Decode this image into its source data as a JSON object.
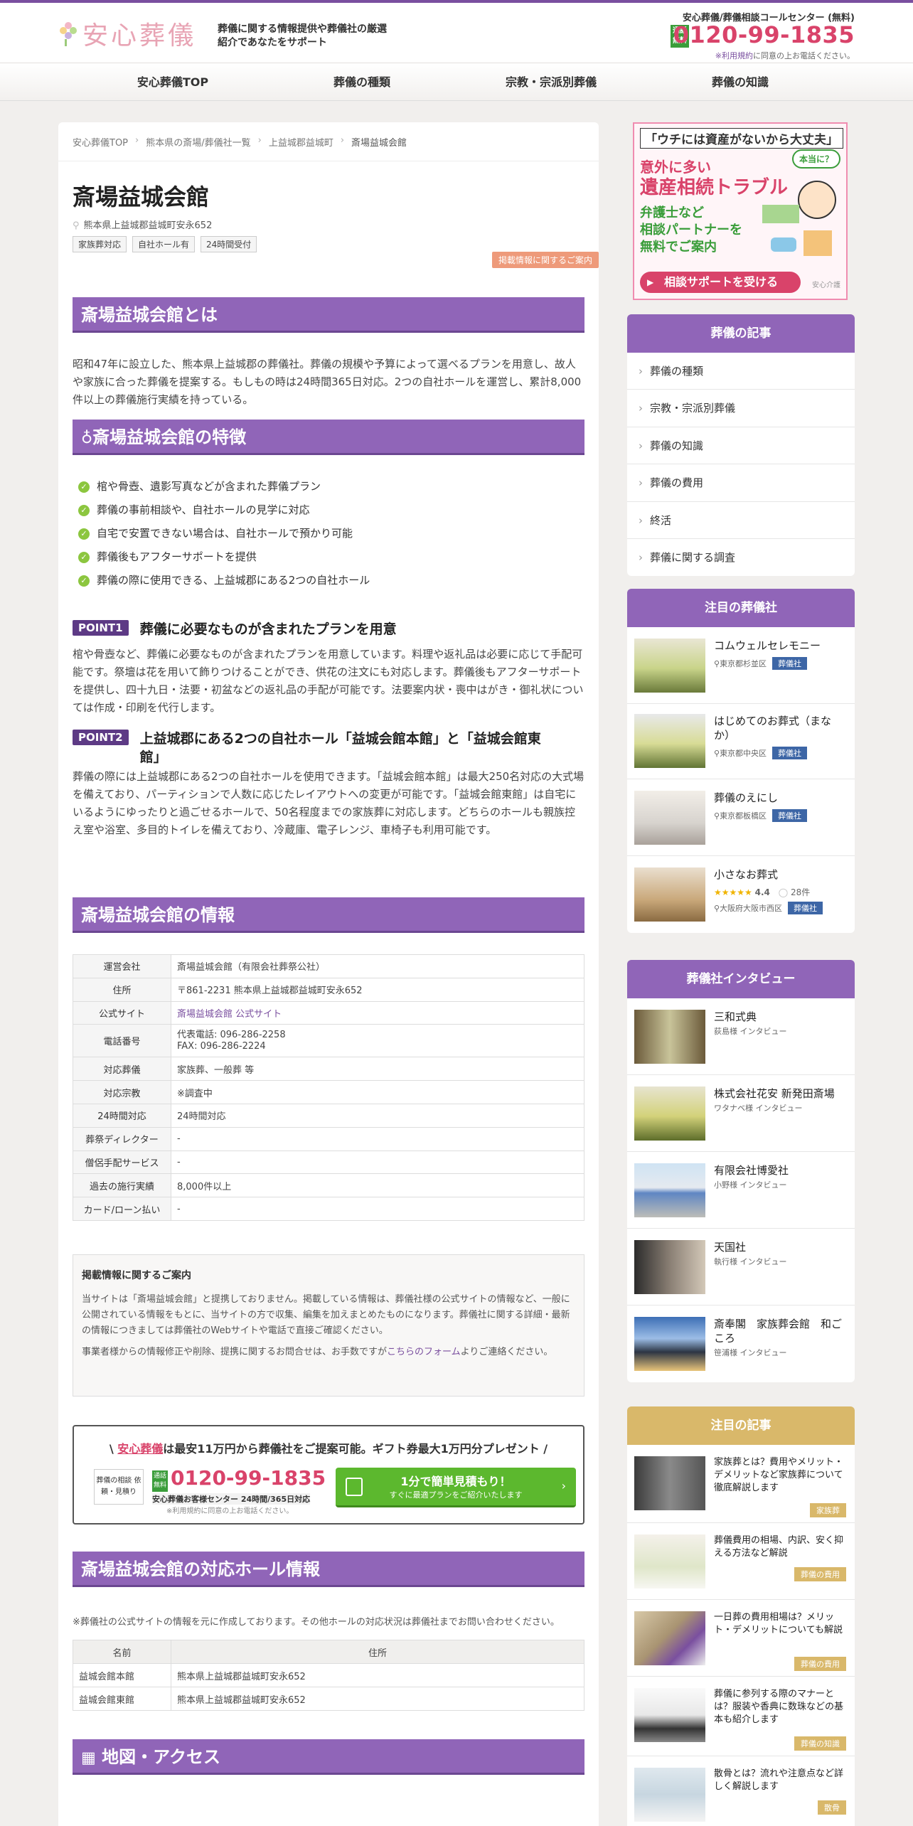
{
  "header": {
    "logo_text": "安心葬儀",
    "tagline": "葬儀に関する情報提供や葬儀社の厳選紹介であなたをサポート",
    "callcenter_title": "安心葬儀/葬儀相談コールセンター (無料)",
    "free_badge": "通話無料",
    "phone": "0120-99-1835",
    "note_link": "※利用規約",
    "note_text": "に同意の上お電話ください。"
  },
  "nav": [
    "安心葬儀TOP",
    "葬儀の種類",
    "宗教・宗派別葬儀",
    "葬儀の知識"
  ],
  "breadcrumb": [
    "安心葬儀TOP",
    "熊本県の斎場/葬儀社一覧",
    "上益城郡益城町",
    "斎場益城会館"
  ],
  "page": {
    "title": "斎場益城会館",
    "address": "熊本県上益城郡益城町安永652",
    "tags": [
      "家族葬対応",
      "自社ホール有",
      "24時間受付"
    ],
    "info_button": "掲載情報に関するご案内"
  },
  "about": {
    "heading": "斎場益城会館とは",
    "text": "昭和47年に設立した、熊本県上益城郡の葬儀社。葬儀の規模や予算によって選べるプランを用意し、故人や家族に合った葬儀を提案する。もしもの時は24時間365日対応。2つの自社ホールを運営し、累計8,000件以上の葬儀施行実績を持っている。"
  },
  "features": {
    "heading": "斎場益城会館の特徴",
    "items": [
      "棺や骨壺、遺影写真などが含まれた葬儀プラン",
      "葬儀の事前相談や、自社ホールの見学に対応",
      "自宅で安置できない場合は、自社ホールで預かり可能",
      "葬儀後もアフターサポートを提供",
      "葬儀の際に使用できる、上益城郡にある2つの自社ホール"
    ]
  },
  "points": [
    {
      "badge": "POINT1",
      "title": "葬儀に必要なものが含まれたプランを用意",
      "text": "棺や骨壺など、葬儀に必要なものが含まれたプランを用意しています。料理や返礼品は必要に応じて手配可能です。祭壇は花を用いて飾りつけることができ、供花の注文にも対応します。葬儀後もアフターサポートを提供し、四十九日・法要・初盆などの返礼品の手配が可能です。法要案内状・喪中はがき・御礼状については作成・印刷を代行します。"
    },
    {
      "badge": "POINT2",
      "title": "上益城郡にある2つの自社ホール「益城会館本館」と「益城会館東館」",
      "text": "葬儀の際には上益城郡にある2つの自社ホールを使用できます。「益城会館本館」は最大250名対応の大式場を備えており、パーティションで人数に応じたレイアウトへの変更が可能です。「益城会館東館」は自宅にいるようにゆったりと過ごせるホールで、50名程度までの家族葬に対応します。どちらのホールも親族控え室や浴室、多目的トイレを備えており、冷蔵庫、電子レンジ、車椅子も利用可能です。"
    }
  ],
  "info": {
    "heading": "斎場益城会館の情報",
    "rows": [
      {
        "k": "運営会社",
        "v": "斎場益城会館（有限会社葬祭公社）"
      },
      {
        "k": "住所",
        "v": "〒861-2231 熊本県上益城郡益城町安永652"
      },
      {
        "k": "公式サイト",
        "v": "斎場益城会館 公式サイト"
      },
      {
        "k": "電話番号",
        "v": "代表電話: 096-286-2258",
        "v2": "FAX: 096-286-2224"
      },
      {
        "k": "対応葬儀",
        "v": "家族葬、一般葬 等"
      },
      {
        "k": "対応宗教",
        "v": "※調査中"
      },
      {
        "k": "24時間対応",
        "v": "24時間対応"
      },
      {
        "k": "葬祭ディレクター",
        "v": "-"
      },
      {
        "k": "僧侶手配サービス",
        "v": "-"
      },
      {
        "k": "過去の施行実績",
        "v": "8,000件以上"
      },
      {
        "k": "カード/ローン払い",
        "v": "-"
      }
    ]
  },
  "notice": {
    "title": "掲載情報に関するご案内",
    "p1": "当サイトは「斎場益城会館」と提携しておりません。掲載している情報は、葬儀社様の公式サイトの情報など、一般に公開されている情報をもとに、当サイトの方で収集、編集を加えまとめたものになります。葬儀社に関する詳細・最新の情報につきましては葬儀社のWebサイトや電話で直接ご確認ください。",
    "p2_a": "事業者様からの情報修正や削除、提携に関するお問合せは、お手数ですが",
    "p2_link": "こちらのフォーム",
    "p2_b": "よりご連絡ください。"
  },
  "cta": {
    "head_pre": "\\ ",
    "head_brand": "安心葬儀",
    "head_text": "は最安11万円から葬儀社をご提案可能。ギフト券最大1万円分プレゼント /",
    "box": "葬儀の相談 依頼・見積り",
    "badge": "通話無料",
    "phone": "0120-99-1835",
    "sub": "安心葬儀お客様センター 24時間/365日対応",
    "note": "※利用規約に同意の上お電話ください。",
    "btn1": "1分で簡単見積もり！",
    "btn2": "すぐに最適プランをご紹介いたします"
  },
  "halls": {
    "heading": "斎場益城会館の対応ホール情報",
    "note": "※葬儀社の公式サイトの情報を元に作成しております。その他ホールの対応状況は葬儀社までお問い合わせください。",
    "headers": [
      "名前",
      "住所"
    ],
    "rows": [
      [
        "益城会館本館",
        "熊本県上益城郡益城町安永652"
      ],
      [
        "益城会館東館",
        "熊本県上益城郡益城町安永652"
      ]
    ]
  },
  "map_heading": "地図・アクセス",
  "sidebar": {
    "ad": {
      "t1": "「ウチには資産がないから大丈夫」",
      "t2": "意外に多い",
      "t3": "遺産相続トラブル",
      "t4a": "弁護士など",
      "t4b": "相談パートナーを",
      "t4c": "無料でご案内",
      "bubble": "本当に？",
      "button": "相談サポートを受ける",
      "brand": "安心介護"
    },
    "articles_title": "葬儀の記事",
    "articles": [
      "葬儀の種類",
      "宗教・宗派別葬儀",
      "葬儀の知識",
      "葬儀の費用",
      "終活",
      "葬儀に関する調査"
    ],
    "featured_title": "注目の葬儀社",
    "featured": [
      {
        "name": "コムウェルセレモニー",
        "loc": "東京都杉並区",
        "tag": "葬儀社"
      },
      {
        "name": "はじめてのお葬式（まなか）",
        "loc": "東京都中央区",
        "tag": "葬儀社"
      },
      {
        "name": "葬儀のえにし",
        "loc": "東京都板橋区",
        "tag": "葬儀社"
      },
      {
        "name": "小さなお葬式",
        "stars": "★★★★★",
        "rating": 4.4,
        "reviews": "28件",
        "loc": "大阪府大阪市西区",
        "tag": "葬儀社"
      }
    ],
    "interview_title": "葬儀社インタビュー",
    "interviews": [
      {
        "name": "三和式典",
        "sub": "荻島様 インタビュー"
      },
      {
        "name": "株式会社花安 新発田斎場",
        "sub": "ワタナベ様 インタビュー"
      },
      {
        "name": "有限会社博愛社",
        "sub": "小野様 インタビュー"
      },
      {
        "name": "天国社",
        "sub": "執行様 インタビュー"
      },
      {
        "name": "斎奉閣　家族葬会館　和ごころ",
        "sub": "笹浦様 インタビュー"
      }
    ],
    "pickup_title": "注目の記事",
    "pickups": [
      {
        "title": "家族葬とは？費用やメリット・デメリットなど家族葬について徹底解説します",
        "tag": "家族葬"
      },
      {
        "title": "葬儀費用の相場、内訳、安く抑える方法など解説",
        "tag": "葬儀の費用"
      },
      {
        "title": "一日葬の費用相場は？メリット・デメリットについても解説",
        "tag": "葬儀の費用"
      },
      {
        "title": "葬儀に参列する際のマナーとは？服装や香典に数珠などの基本も紹介します",
        "tag": "葬儀の知識"
      },
      {
        "title": "散骨とは？流れや注意点など詳しく解説します",
        "tag": "散骨"
      }
    ]
  },
  "colors": {
    "accent": "#9065b8",
    "phone": "#d9436a",
    "gold": "#d9b86a"
  }
}
